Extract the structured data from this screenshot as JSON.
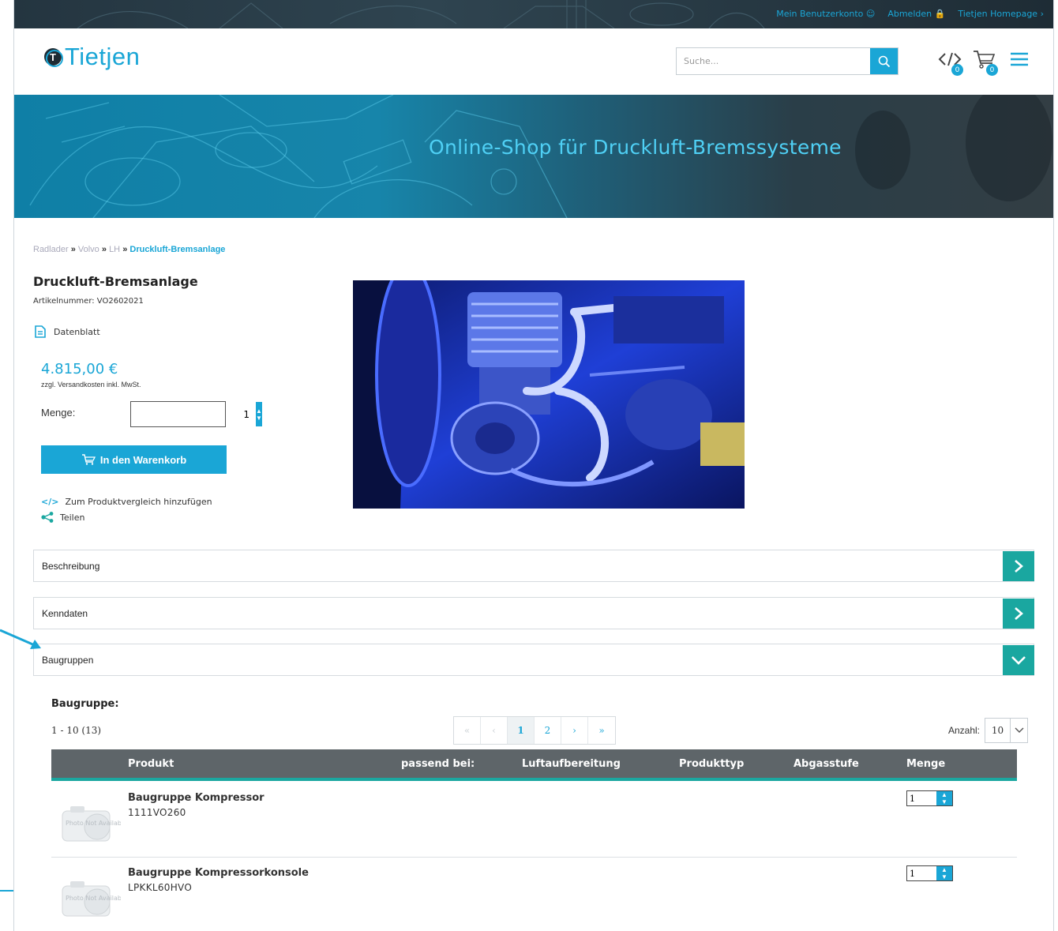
{
  "topbar": {
    "links": [
      "Mein Benutzerkonto",
      "Abmelden",
      "Tietjen Homepage"
    ]
  },
  "header": {
    "logo_text": "Tietjen",
    "logo_mark": "T",
    "search_placeholder": "Suche...",
    "compare_count": "0",
    "cart_count": "0"
  },
  "banner": {
    "title": "Online-Shop für Druckluft-Bremssysteme"
  },
  "breadcrumb": {
    "items": [
      "Radlader",
      "Volvo",
      "LH"
    ],
    "separator": "»",
    "current": "Druckluft-Bremsanlage"
  },
  "product": {
    "title": "Druckluft-Bremsanlage",
    "article_number": "Artikelnummer: VO2602021",
    "datasheet_label": "Datenblatt",
    "price": "4.815,00 €",
    "price_note": "zzgl. Versandkosten inkl. MwSt.",
    "quantity_label": "Menge:",
    "quantity_value": "1",
    "cart_button": "In den Warenkorb",
    "compare_label": "Zum Produktvergleich hinzufügen",
    "share_label": "Teilen"
  },
  "accordions": [
    {
      "label": "Beschreibung",
      "state": "collapsed"
    },
    {
      "label": "Kenndaten",
      "state": "collapsed"
    },
    {
      "label": "Baugruppen",
      "state": "expanded"
    }
  ],
  "baugruppen": {
    "heading": "Baugruppe:",
    "count_text": "1 - 10 (13)",
    "pager": [
      "«",
      "‹",
      "1",
      "2",
      "›",
      "»"
    ],
    "pager_active": "1",
    "per_page_label": "Anzahl:",
    "per_page_value": "10",
    "columns": [
      "Produkt",
      "passend bei:",
      "Luftaufbereitung",
      "Produkttyp",
      "Abgasstufe",
      "Menge"
    ],
    "rows": [
      {
        "name": "Baugruppe Kompressor",
        "code": "1111VO260",
        "qty": "1",
        "thumb_text": "Photo Not Available"
      },
      {
        "name": "Baugruppe Kompressorkonsole",
        "code": "LPKKL60HVO",
        "qty": "1",
        "thumb_text": "Photo Not Available"
      }
    ]
  },
  "colors": {
    "accent": "#1aa6d6",
    "teal": "#1aa7a0",
    "table_header": "#5e6569",
    "topbar": "#243540"
  }
}
